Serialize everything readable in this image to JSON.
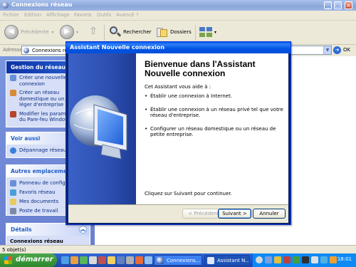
{
  "window": {
    "title": "Connexions réseau"
  },
  "menu": [
    "Fichier",
    "Edition",
    "Affichage",
    "Favoris",
    "Outils",
    "Avancé",
    "?"
  ],
  "toolbar": {
    "back": "Précédente",
    "search": "Rechercher",
    "folders": "Dossiers"
  },
  "address": {
    "label": "Adresse",
    "value": "Connexions réseau",
    "go": "OK"
  },
  "left_pane": {
    "network_tasks": {
      "title": "Gestion du réseau",
      "items": [
        "Créer une nouvelle connexion",
        "Créer un réseau domestique ou un réseau léger d'entreprise",
        "Modifier les paramètres du Pare-feu Windows"
      ]
    },
    "see_also": {
      "title": "Voir aussi",
      "items": [
        "Dépannage réseau"
      ]
    },
    "other_places": {
      "title": "Autres emplacements",
      "items": [
        "Panneau de configuration",
        "Favoris réseau",
        "Mes documents",
        "Poste de travail"
      ]
    },
    "details": {
      "title": "Détails",
      "subtitle": "Connexions réseau"
    }
  },
  "statusbar": {
    "text": "5 objet(s)"
  },
  "taskbar": {
    "start": "démarrer",
    "tasks": [
      "Connexions...",
      "Assistant N..."
    ],
    "clock": "18:01"
  },
  "dialog": {
    "title": "Assistant Nouvelle connexion",
    "heading": "Bienvenue dans l'Assistant Nouvelle connexion",
    "intro": "Cet Assistant vous aide à :",
    "bullets": [
      "Établir une connexion à Internet.",
      "Établir une connexion à un réseau privé tel que votre réseau d'entreprise.",
      "Configurer un réseau domestique ou un réseau de petite entreprise."
    ],
    "footer": "Cliquez sur Suivant pour continuer.",
    "buttons": {
      "back": "< Précédent",
      "next": "Suivant >",
      "cancel": "Annuler"
    }
  },
  "colors": {
    "accent": "#0054e3",
    "task_pane": "#d6dff7",
    "start": "#2f8a2f"
  }
}
